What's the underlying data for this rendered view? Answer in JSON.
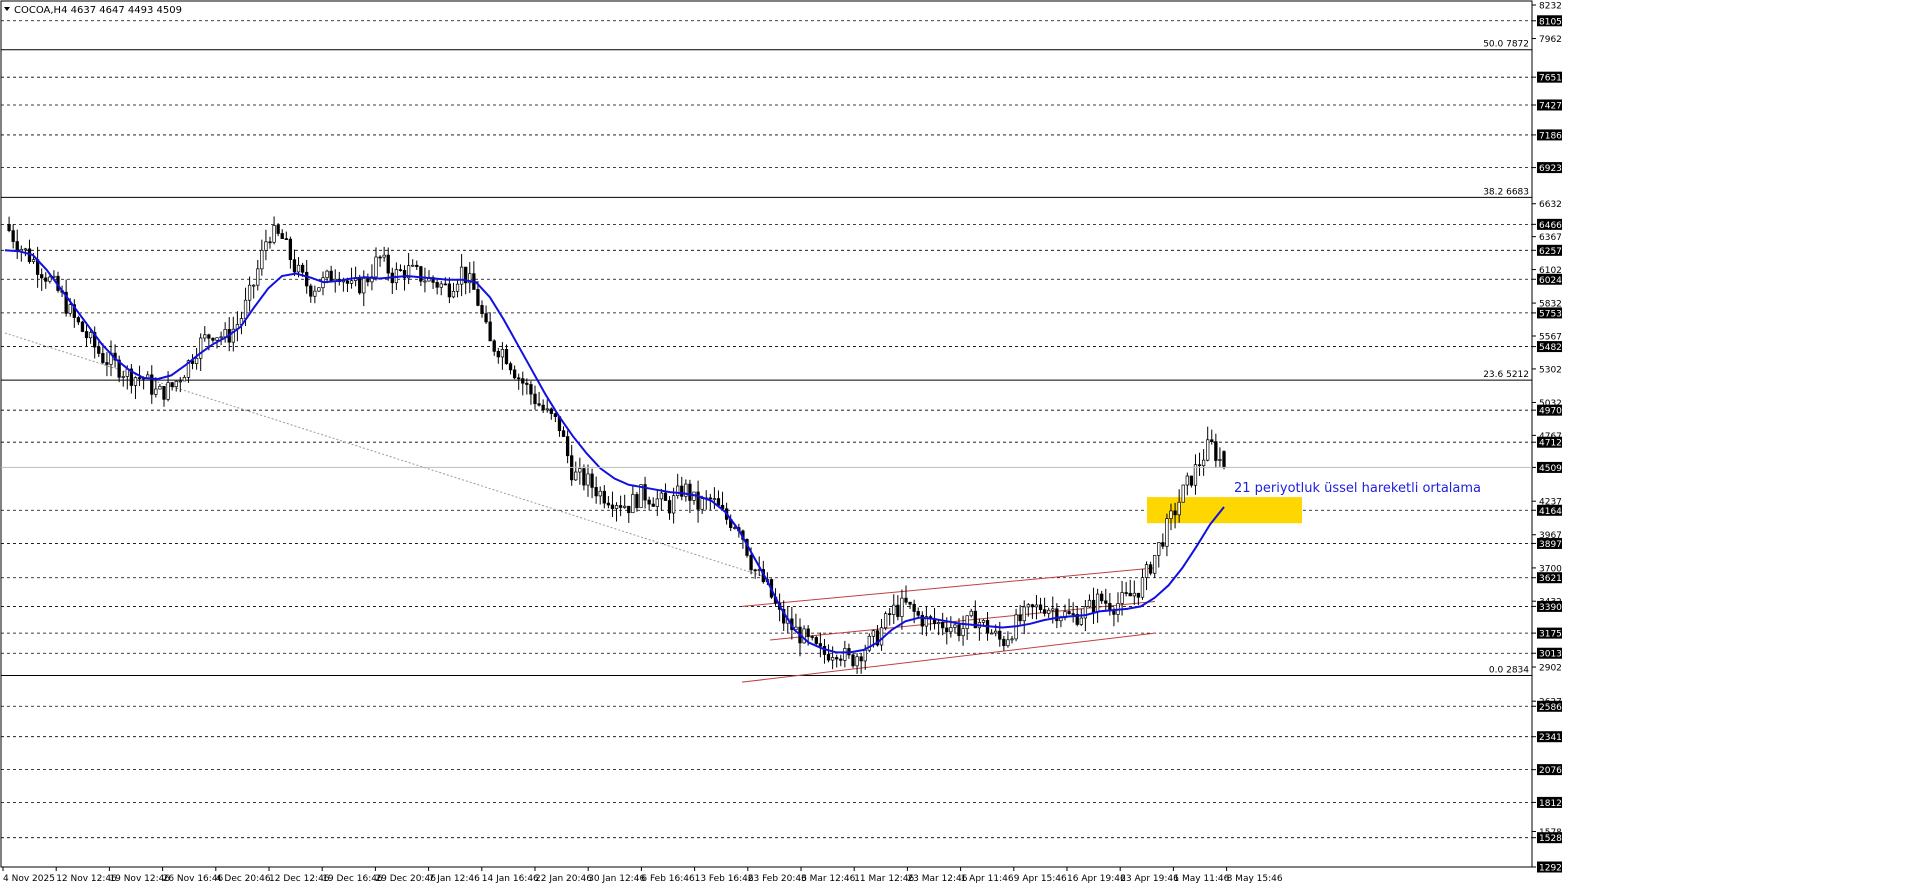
{
  "header": {
    "symbol_line": "COCOA,H4  4637 4647 4493 4509"
  },
  "annotation": {
    "text": "21 periyotluk üssel hareketli ortalama"
  },
  "chart_data": {
    "type": "candlestick",
    "symbol": "COCOA",
    "timeframe": "H4",
    "ohlc_last": {
      "open": 4637,
      "high": 4647,
      "low": 4493,
      "close": 4509
    },
    "current_price": 4509,
    "ylim": [
      1292,
      8232
    ],
    "y_ticks": [
      8232,
      8105,
      7962,
      7651,
      7427,
      7186,
      6923,
      6632,
      6466,
      6367,
      6257,
      6102,
      6024,
      5832,
      5753,
      5567,
      5482,
      5302,
      5032,
      4970,
      4767,
      4712,
      4509,
      4237,
      4164,
      3967,
      3897,
      3700,
      3621,
      3432,
      3390,
      3175,
      3013,
      2902,
      2627,
      2586,
      2341,
      2076,
      1812,
      1578,
      1528,
      1292
    ],
    "y_ticks_boxed": [
      8105,
      7651,
      7427,
      7186,
      6923,
      6466,
      6257,
      6024,
      5753,
      5482,
      4970,
      4712,
      4509,
      4164,
      3897,
      3621,
      3390,
      3175,
      3013,
      2586,
      2341,
      2076,
      1812,
      1528,
      1292
    ],
    "x_ticks": [
      "4 Nov 2025",
      "12 Nov 12:46",
      "19 Nov 12:46",
      "26 Nov 16:46",
      "4 Dec 20:46",
      "12 Dec 12:46",
      "19 Dec 16:46",
      "29 Dec 20:46",
      "7 Jan 12:46",
      "14 Jan 16:46",
      "22 Jan 20:46",
      "30 Jan 12:46",
      "6 Feb 16:46",
      "13 Feb 16:46",
      "23 Feb 20:46",
      "3 Mar 12:46",
      "11 Mar 12:46",
      "23 Mar 12:46",
      "1 Apr 11:46",
      "9 Apr 15:46",
      "16 Apr 19:46",
      "23 Apr 19:46",
      "1 May 11:46",
      "8 May 15:46"
    ],
    "fibonacci": [
      {
        "label": "50.0",
        "price": 7872
      },
      {
        "label": "38.2",
        "price": 6683
      },
      {
        "label": "23.6",
        "price": 5212
      },
      {
        "label": "0.0",
        "price": 2834
      }
    ],
    "series": [
      {
        "name": "21 periyotluk üssel hareketli ortalama",
        "close_path": [
          6466,
          6300,
          6180,
          6050,
          5900,
          5700,
          5550,
          5400,
          5330,
          5250,
          5230,
          5100,
          5150,
          5300,
          5500,
          5600,
          5550,
          5700,
          6000,
          6400,
          6350,
          6100,
          5950,
          6000,
          6100,
          5950,
          6000,
          6200,
          6050,
          6100,
          6050,
          6000,
          5950,
          6100,
          5900,
          5500,
          5450,
          5250,
          5100,
          4950,
          4850,
          4450,
          4400,
          4300,
          4250,
          4200,
          4300,
          4250,
          4200,
          4350,
          4200,
          4250,
          4100,
          4050,
          3700,
          3550,
          3300,
          3200,
          3100,
          3000,
          3050,
          2950,
          3050,
          3150,
          3350,
          3400,
          3300,
          3250,
          3250,
          3200,
          3300,
          3200,
          3100,
          3250,
          3350,
          3400,
          3350,
          3300,
          3350,
          3450,
          3400,
          3450,
          3550,
          3800,
          4050,
          4300,
          4500,
          4700,
          4509
        ],
        "ema_21": [
          6257,
          6250,
          6220,
          6100,
          5950,
          5800,
          5650,
          5500,
          5380,
          5290,
          5230,
          5220,
          5250,
          5330,
          5420,
          5500,
          5560,
          5640,
          5800,
          5950,
          6050,
          6070,
          6040,
          6000,
          6010,
          6030,
          6040,
          6030,
          6040,
          6050,
          6040,
          6030,
          6020,
          6020,
          6000,
          5880,
          5700,
          5500,
          5300,
          5100,
          4920,
          4760,
          4620,
          4500,
          4420,
          4370,
          4350,
          4330,
          4310,
          4300,
          4280,
          4240,
          4150,
          4000,
          3800,
          3600,
          3380,
          3200,
          3100,
          3050,
          3020,
          3020,
          3040,
          3100,
          3200,
          3270,
          3300,
          3290,
          3270,
          3250,
          3240,
          3230,
          3220,
          3230,
          3250,
          3280,
          3300,
          3310,
          3320,
          3350,
          3360,
          3370,
          3390,
          3460,
          3560,
          3700,
          3870,
          4050,
          4190
        ]
      }
    ],
    "trend_channel": [
      {
        "from": {
          "date": "25 Feb 2026",
          "price": 3390
        },
        "to": {
          "date": "13 May 2026",
          "price": 3700
        }
      },
      {
        "from": {
          "date": "26 Feb 2026",
          "price": 3120
        },
        "to": {
          "date": "13 May 2026",
          "price": 3430
        }
      },
      {
        "from": {
          "date": "25 Feb 2026",
          "price": 2780
        },
        "to": {
          "date": "13 May 2026",
          "price": 3175
        }
      }
    ],
    "highlight_zone": {
      "price_low": 4060,
      "price_high": 4270,
      "color": "#ffd700"
    },
    "colors": {
      "ema": "#1010e0",
      "channel": "#c04040",
      "zone": "#ffd700",
      "boxed_label": "#000000"
    }
  }
}
